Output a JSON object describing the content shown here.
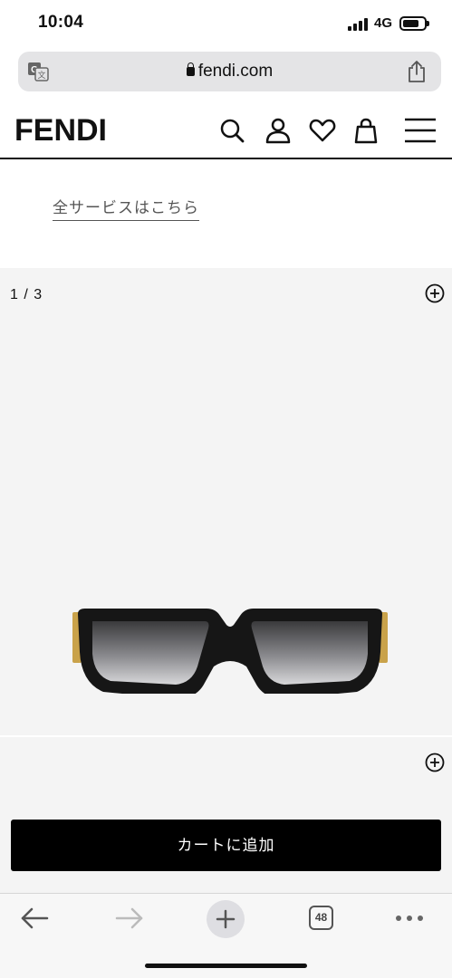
{
  "status_bar": {
    "time": "10:04",
    "network": "4G"
  },
  "browser": {
    "url": "fendi.com",
    "tab_count": "48"
  },
  "site": {
    "logo": "FENDI",
    "all_services_link": "全サービスはこちら"
  },
  "gallery": {
    "counter": "1 / 3"
  },
  "product": {
    "add_to_cart_label": "カートに追加"
  },
  "icons": {
    "translate": "translate-icon",
    "share": "share-icon",
    "search": "search-icon",
    "account": "user-icon",
    "wishlist": "heart-icon",
    "bag": "shopping-bag-icon",
    "menu": "hamburger-menu-icon",
    "zoom": "zoom-plus-icon",
    "back": "back-arrow-icon",
    "forward": "forward-arrow-icon",
    "new_tab": "plus-icon",
    "more": "more-dots-icon"
  },
  "colors": {
    "cart_button": "#000000",
    "gallery_bg": "#f4f4f4",
    "url_bar_bg": "#e4e4e6"
  }
}
